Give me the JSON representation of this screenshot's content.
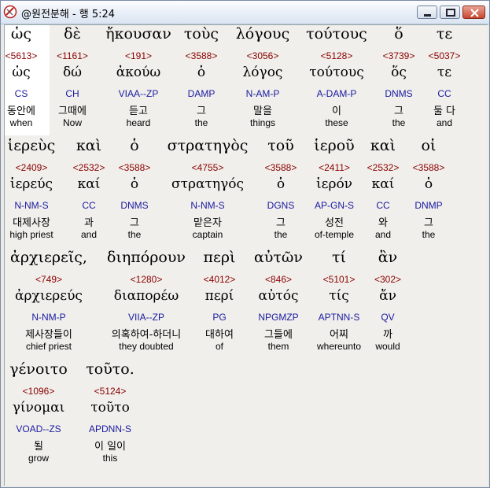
{
  "window": {
    "title": "@원전분해 - 행 5:24"
  },
  "rows": [
    [
      {
        "g": "ὡς",
        "s": "<5613>",
        "l": "ὡς",
        "p": "CS",
        "k": "동안에",
        "e": "when"
      },
      {
        "g": "δὲ",
        "s": "<1161>",
        "l": "δώ",
        "p": "CH",
        "k": "그때에",
        "e": "Now"
      },
      {
        "g": "ἤκουσαν",
        "s": "<191>",
        "l": "ἀκούω",
        "p": "VIAA--ZP",
        "k": "듣고",
        "e": "heard"
      },
      {
        "g": "τοὺς",
        "s": "<3588>",
        "l": "ὁ",
        "p": "DAMP",
        "k": "그",
        "e": "the"
      },
      {
        "g": "λόγους",
        "s": "<3056>",
        "l": "λόγος",
        "p": "N-AM-P",
        "k": "말을",
        "e": "things"
      },
      {
        "g": "τούτους",
        "s": "<5128>",
        "l": "τούτους",
        "p": "A-DAM-P",
        "k": "이",
        "e": "these"
      },
      {
        "g": "ὅ",
        "s": "<3739>",
        "l": "ὅς",
        "p": "DNMS",
        "k": "그",
        "e": "the"
      },
      {
        "g": "τε",
        "s": "<5037>",
        "l": "τε",
        "p": "CC",
        "k": "둘 다",
        "e": "and"
      }
    ],
    [
      {
        "g": "ἱερεὺς",
        "s": "<2409>",
        "l": "ἱερεύς",
        "p": "N-NM-S",
        "k": "대제사장",
        "e": "high priest"
      },
      {
        "g": "καὶ",
        "s": "<2532>",
        "l": "καί",
        "p": "CC",
        "k": "과",
        "e": "and"
      },
      {
        "g": "ὁ",
        "s": "<3588>",
        "l": "ὁ",
        "p": "DNMS",
        "k": "그",
        "e": "the"
      },
      {
        "g": "στρατηγὸς",
        "s": "<4755>",
        "l": "στρατηγός",
        "p": "N-NM-S",
        "k": "맡은자",
        "e": "captain"
      },
      {
        "g": "τοῦ",
        "s": "<3588>",
        "l": "ὁ",
        "p": "DGNS",
        "k": "그",
        "e": "the"
      },
      {
        "g": "ἱεροῦ",
        "s": "<2411>",
        "l": "ἱερόν",
        "p": "AP-GN-S",
        "k": "성전",
        "e": "of-temple"
      },
      {
        "g": "καὶ",
        "s": "<2532>",
        "l": "καί",
        "p": "CC",
        "k": "와",
        "e": "and"
      },
      {
        "g": "οἱ",
        "s": "<3588>",
        "l": "ὁ",
        "p": "DNMP",
        "k": "그",
        "e": "the"
      }
    ],
    [
      {
        "g": "ἀρχιερεῖς,",
        "s": "<749>",
        "l": "ἀρχιερεύς",
        "p": "N-NM-P",
        "k": "제사장들이",
        "e": "chief priest"
      },
      {
        "g": "διηπόρουν",
        "s": "<1280>",
        "l": "διαπορέω",
        "p": "VIIA--ZP",
        "k": "의혹하여-하더니",
        "e": "they doubted"
      },
      {
        "g": "περὶ",
        "s": "<4012>",
        "l": "περί",
        "p": "PG",
        "k": "대하여",
        "e": "of"
      },
      {
        "g": "αὐτῶν",
        "s": "<846>",
        "l": "αὐτός",
        "p": "NPGMZP",
        "k": "그들에",
        "e": "them"
      },
      {
        "g": "τί",
        "s": "<5101>",
        "l": "τίς",
        "p": "APTNN-S",
        "k": "어찌",
        "e": "whereunto"
      },
      {
        "g": "ἂν",
        "s": "<302>",
        "l": "ἄν",
        "p": "QV",
        "k": "까",
        "e": "would"
      }
    ],
    [
      {
        "g": "γένοιτο",
        "s": "<1096>",
        "l": "γίνομαι",
        "p": "VOAD--ZS",
        "k": "될",
        "e": "grow"
      },
      {
        "g": "τοῦτο.",
        "s": "<5124>",
        "l": "τοῦτο",
        "p": "APDNN-S",
        "k": "이 일이",
        "e": "this"
      }
    ]
  ]
}
